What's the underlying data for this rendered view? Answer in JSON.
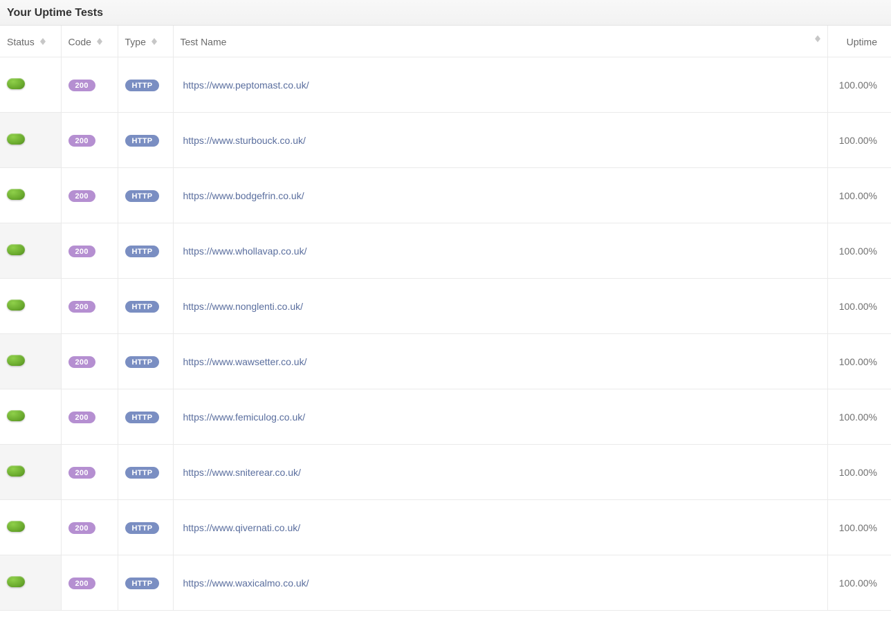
{
  "header": {
    "title": "Your Uptime Tests"
  },
  "columns": {
    "status": "Status",
    "code": "Code",
    "type": "Type",
    "test_name": "Test Name",
    "uptime": "Uptime"
  },
  "rows": [
    {
      "code": "200",
      "type": "HTTP",
      "name": "https://www.peptomast.co.uk/",
      "uptime": "100.00%"
    },
    {
      "code": "200",
      "type": "HTTP",
      "name": "https://www.sturbouck.co.uk/",
      "uptime": "100.00%"
    },
    {
      "code": "200",
      "type": "HTTP",
      "name": "https://www.bodgefrin.co.uk/",
      "uptime": "100.00%"
    },
    {
      "code": "200",
      "type": "HTTP",
      "name": "https://www.whollavap.co.uk/",
      "uptime": "100.00%"
    },
    {
      "code": "200",
      "type": "HTTP",
      "name": "https://www.nonglenti.co.uk/",
      "uptime": "100.00%"
    },
    {
      "code": "200",
      "type": "HTTP",
      "name": "https://www.wawsetter.co.uk/",
      "uptime": "100.00%"
    },
    {
      "code": "200",
      "type": "HTTP",
      "name": "https://www.femiculog.co.uk/",
      "uptime": "100.00%"
    },
    {
      "code": "200",
      "type": "HTTP",
      "name": "https://www.sniterear.co.uk/",
      "uptime": "100.00%"
    },
    {
      "code": "200",
      "type": "HTTP",
      "name": "https://www.qivernati.co.uk/",
      "uptime": "100.00%"
    },
    {
      "code": "200",
      "type": "HTTP",
      "name": "https://www.waxicalmo.co.uk/",
      "uptime": "100.00%"
    }
  ]
}
